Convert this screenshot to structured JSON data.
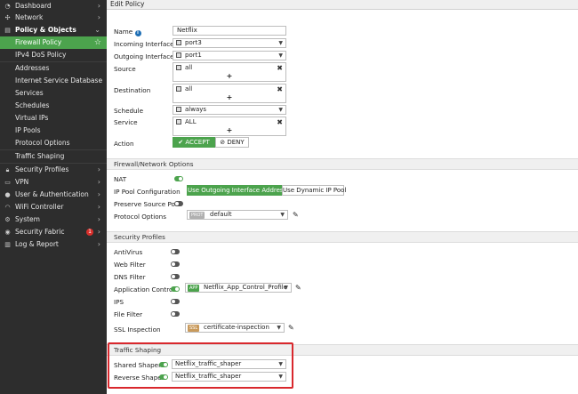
{
  "sidebar": {
    "items": [
      {
        "label": "Dashboard",
        "icon": "dashboard-icon"
      },
      {
        "label": "Network",
        "icon": "network-icon"
      },
      {
        "label": "Policy & Objects",
        "icon": "policy-icon"
      },
      {
        "label": "Firewall Policy"
      },
      {
        "label": "IPv4 DoS Policy"
      },
      {
        "label": "Addresses"
      },
      {
        "label": "Internet Service Database"
      },
      {
        "label": "Services"
      },
      {
        "label": "Schedules"
      },
      {
        "label": "Virtual IPs"
      },
      {
        "label": "IP Pools"
      },
      {
        "label": "Protocol Options"
      },
      {
        "label": "Traffic Shaping"
      },
      {
        "label": "Security Profiles",
        "icon": "lock-icon"
      },
      {
        "label": "VPN",
        "icon": "monitor-icon"
      },
      {
        "label": "User & Authentication",
        "icon": "user-icon"
      },
      {
        "label": "WiFi Controller",
        "icon": "wifi-icon"
      },
      {
        "label": "System",
        "icon": "gear-icon"
      },
      {
        "label": "Security Fabric",
        "icon": "fabric-icon",
        "badge": "1"
      },
      {
        "label": "Log & Report",
        "icon": "chart-icon"
      }
    ]
  },
  "header": {
    "title": "Edit Policy"
  },
  "form": {
    "name": {
      "label": "Name",
      "value": "Netflix"
    },
    "incoming": {
      "label": "Incoming Interface",
      "value": "port3"
    },
    "outgoing": {
      "label": "Outgoing Interface",
      "value": "port1"
    },
    "source": {
      "label": "Source",
      "value": "all"
    },
    "destination": {
      "label": "Destination",
      "value": "all"
    },
    "schedule": {
      "label": "Schedule",
      "value": "always"
    },
    "service": {
      "label": "Service",
      "value": "ALL"
    },
    "action": {
      "label": "Action",
      "accept": "✔ ACCEPT",
      "deny": "⊘ DENY"
    }
  },
  "firewall_options": {
    "title": "Firewall/Network Options",
    "nat": {
      "label": "NAT",
      "on": true
    },
    "ip_pool": {
      "label": "IP Pool Configuration",
      "opt1": "Use Outgoing Interface Address",
      "opt2": "Use Dynamic IP Pool"
    },
    "preserve": {
      "label": "Preserve Source Port",
      "on": false
    },
    "protocol": {
      "label": "Protocol Options",
      "tag": "PROT",
      "value": "default"
    }
  },
  "security_profiles": {
    "title": "Security Profiles",
    "antivirus": {
      "label": "AntiVirus",
      "on": false
    },
    "webfilter": {
      "label": "Web Filter",
      "on": false
    },
    "dnsfilter": {
      "label": "DNS Filter",
      "on": false
    },
    "appcontrol": {
      "label": "Application Control",
      "on": true,
      "tag": "APP",
      "value": "Netflix_App_Control_Profile"
    },
    "ips": {
      "label": "IPS",
      "on": false
    },
    "filefilter": {
      "label": "File Filter",
      "on": false
    },
    "ssl": {
      "label": "SSL Inspection",
      "tag": "SSL",
      "value": "certificate-inspection"
    }
  },
  "traffic_shaping": {
    "title": "Traffic Shaping",
    "shared": {
      "label": "Shared Shaper",
      "on": true,
      "value": "Netflix_traffic_shaper"
    },
    "reverse": {
      "label": "Reverse Shaper",
      "on": true,
      "value": "Netflix_traffic_shaper"
    }
  },
  "colors": {
    "accent": "#4ca34d",
    "sidebar": "#2d2d2d",
    "highlight": "#d9282d"
  }
}
